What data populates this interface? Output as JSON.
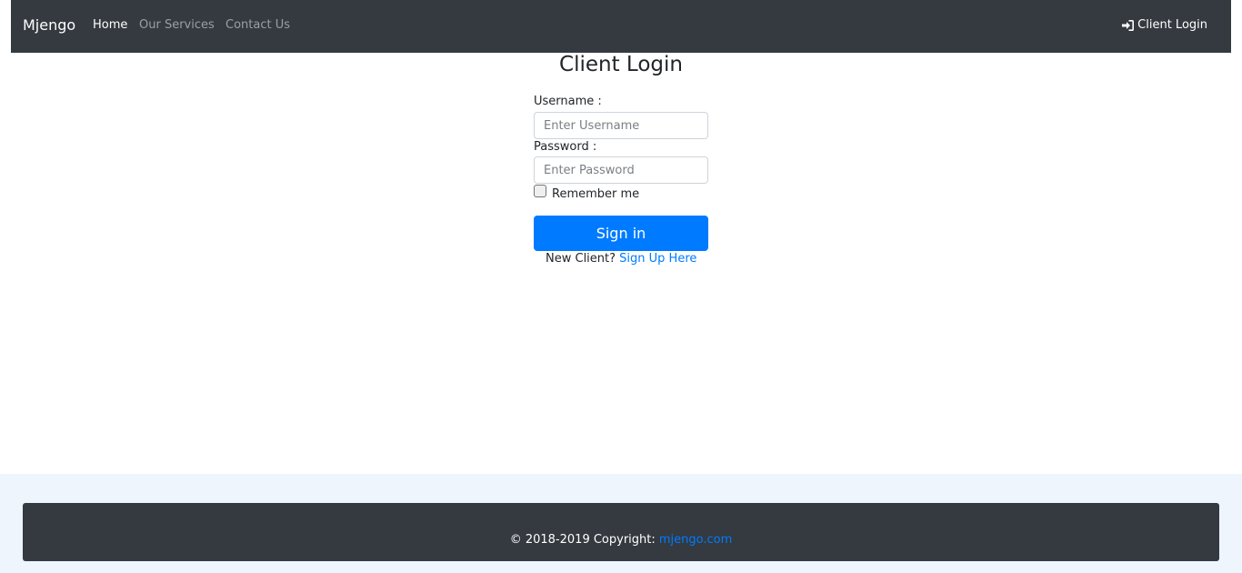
{
  "navbar": {
    "brand": "Mjengo",
    "links": [
      {
        "label": "Home",
        "active": true
      },
      {
        "label": "Our Services",
        "active": false
      },
      {
        "label": "Contact Us",
        "active": false
      }
    ],
    "login_icon": "sign-in-icon",
    "login_label": "Client Login"
  },
  "login": {
    "title": "Client Login",
    "username_label": "Username :",
    "username_placeholder": "Enter Username",
    "username_value": "",
    "password_label": "Password :",
    "password_placeholder": "Enter Password",
    "password_value": "",
    "remember_label": "Remember me",
    "remember_checked": false,
    "signin_label": "Sign in",
    "new_client_text": "New Client?",
    "signup_link": "Sign Up Here"
  },
  "footer": {
    "copyright_text": "© 2018-2019 Copyright:",
    "site_link": "mjengo.com"
  },
  "colors": {
    "navbar_bg": "#343a40",
    "primary": "#007bff",
    "footer_band": "#eef5fd"
  }
}
